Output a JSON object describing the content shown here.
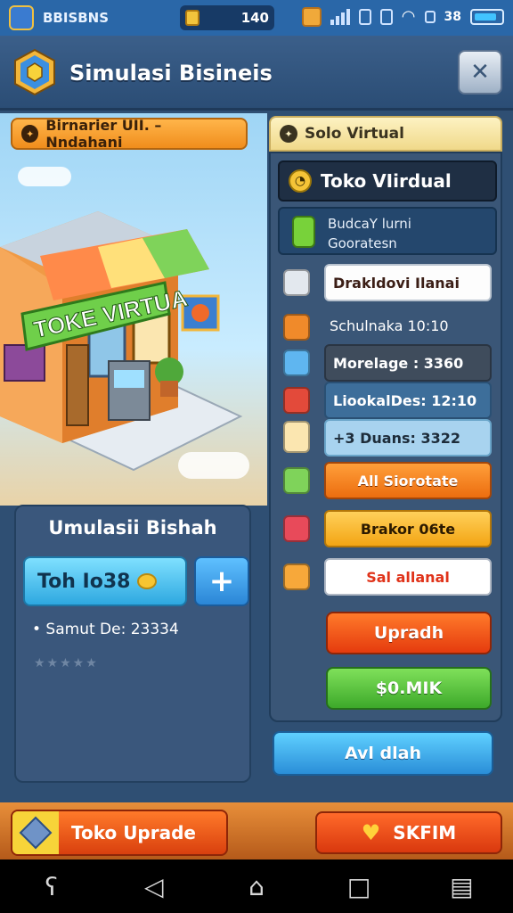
{
  "status_bar": {
    "app_name": "BBISBNS",
    "coins": "140",
    "time": "38"
  },
  "header": {
    "title": "Simulasi Bisineis"
  },
  "tabs": {
    "left_tab": "Birnarier UII. – Nndahani",
    "right_tab": "Solo Virtual"
  },
  "scene": {
    "store_sign": "TOKE VIRTUA"
  },
  "left_panel": {
    "title": "Umulasii Bishah",
    "store_button": "Toh Io38",
    "stat": "• Samut De: 23334",
    "stars": "★★★★★"
  },
  "right_panel": {
    "header": "Toko VIirdual",
    "description_line1": "BudcaY lurni",
    "description_line2": "Gooratesn",
    "rows": [
      {
        "label": "Drakldovi Ilanai",
        "style": "white"
      },
      {
        "label": "Schulnaka 10:10",
        "style": "plain"
      },
      {
        "label": "Morelage : 3360",
        "style": "dark"
      },
      {
        "label": "LiookalDes: 12:10",
        "style": "blue"
      },
      {
        "label": "+3 Duans: 3322",
        "style": "light"
      },
      {
        "label": "All Siorotate",
        "style": "orange"
      },
      {
        "label": "Brakor 06te",
        "style": "yellow"
      },
      {
        "label": "Sal allanal",
        "style": "white-red"
      }
    ],
    "upgrade_button": "Upradh",
    "green_button": "$0.MIK",
    "chat_button": "Avl dlah"
  },
  "bottom_bar": {
    "left_button": "Toko Uprade",
    "right_button": "SKFIM"
  },
  "nav": {
    "back": "◁",
    "home": "⌂",
    "recent": "□"
  },
  "colors": {
    "primary_blue": "#2a67a8",
    "panel": "#3a5677",
    "accent_orange": "#ec6d0f",
    "accent_green": "#3da92a"
  }
}
